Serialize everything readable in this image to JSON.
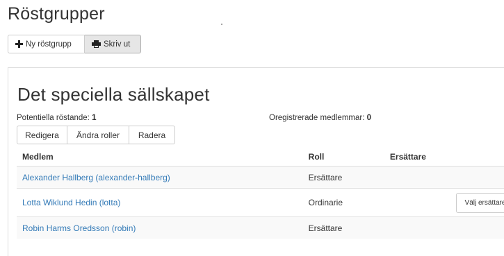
{
  "page": {
    "title": "Röstgrupper"
  },
  "toolbar": {
    "new_group_label": "Ny röstgrupp",
    "print_label": "Skriv ut"
  },
  "group": {
    "title": "Det speciella sällskapet",
    "potential_voters_label": "Potentiella röstande:",
    "potential_voters_count": "1",
    "unregistered_label": "Oregistrerade medlemmar:",
    "unregistered_count": "0",
    "actions": {
      "edit_label": "Redigera",
      "change_roles_label": "Ändra roller",
      "delete_label": "Radera"
    },
    "table": {
      "headers": {
        "member": "Medlem",
        "role": "Roll",
        "substitute": "Ersättare"
      },
      "rows": [
        {
          "member": "Alexander Hallberg (alexander-hallberg)",
          "role": "Ersättare",
          "substitute": "",
          "action": ""
        },
        {
          "member": "Lotta Wiklund Hedin (lotta)",
          "role": "Ordinarie",
          "substitute": "",
          "action": "Välj ersättare"
        },
        {
          "member": "Robin Harms Oredsson (robin)",
          "role": "Ersättare",
          "substitute": "",
          "action": ""
        }
      ]
    }
  },
  "icons": {
    "new_group": "plus-icon",
    "print": "print-icon"
  },
  "colors": {
    "link": "#337ab7",
    "border": "#cccccc",
    "active_button": "#e6e6e6"
  }
}
